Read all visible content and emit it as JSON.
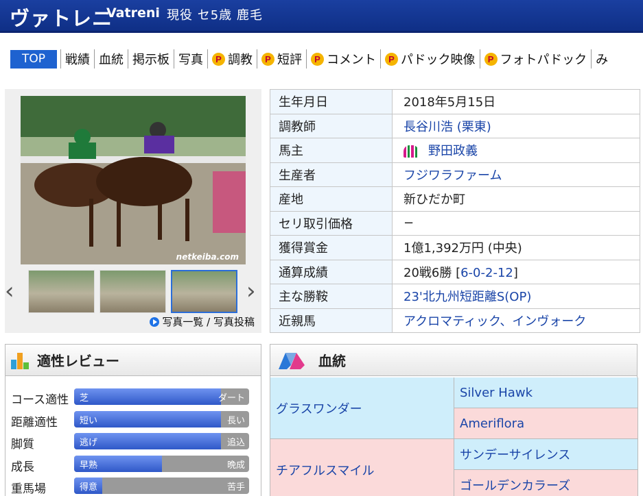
{
  "header": {
    "name_ja": "ヴァトレニ",
    "name_en": "Vatreni",
    "meta": "現役 セ5歳 鹿毛"
  },
  "nav": {
    "top_label": "TOP",
    "items": [
      {
        "label": "戦績",
        "premium": false
      },
      {
        "label": "血統",
        "premium": false
      },
      {
        "label": "掲示板",
        "premium": false
      },
      {
        "label": "写真",
        "premium": false
      },
      {
        "label": "調教",
        "premium": true
      },
      {
        "label": "短評",
        "premium": true
      },
      {
        "label": "コメント",
        "premium": true
      },
      {
        "label": "パドック映像",
        "premium": true
      },
      {
        "label": "フォトパドック",
        "premium": true
      },
      {
        "label": "み",
        "premium": false
      }
    ],
    "premium_badge": "P"
  },
  "photos": {
    "watermark": "netkeiba.com",
    "links": "写真一覧 / 写真投稿",
    "prev_arrow": "‹",
    "next_arrow": "›"
  },
  "profile": {
    "rows": [
      {
        "label": "生年月日",
        "value": "2018年5月15日",
        "link": false
      },
      {
        "label": "調教師",
        "value": "長谷川浩 (栗東)",
        "link": true
      },
      {
        "label": "馬主",
        "value": "野田政義",
        "link": true,
        "silk": true
      },
      {
        "label": "生産者",
        "value": "フジワラファーム",
        "link": true
      },
      {
        "label": "産地",
        "value": "新ひだか町",
        "link": false
      },
      {
        "label": "セリ取引価格",
        "value": "−",
        "link": false
      },
      {
        "label": "獲得賞金",
        "value": "1億1,392万円 (中央)",
        "link": false
      },
      {
        "label": "通算成績",
        "value": "20戦6勝 [",
        "value_link": "6-0-2-12",
        "value_tail": "]",
        "link": false
      },
      {
        "label": "主な勝鞍",
        "value": "23'北九州短距離S(OP)",
        "link": true
      },
      {
        "label": "近親馬",
        "value": "アクロマティック、インヴォーク",
        "link": true
      }
    ]
  },
  "aptitude": {
    "title": "適性レビュー",
    "rows": [
      {
        "label": "コース適性",
        "left": "芝",
        "right": "ダート",
        "level": 0.84
      },
      {
        "label": "距離適性",
        "left": "短い",
        "right": "長い",
        "level": 0.84
      },
      {
        "label": "脚質",
        "left": "逃げ",
        "right": "追込",
        "level": 0.84
      },
      {
        "label": "成長",
        "left": "早熟",
        "right": "晩成",
        "level": 0.5
      },
      {
        "label": "重馬場",
        "left": "得意",
        "right": "苦手",
        "level": 0.16
      }
    ]
  },
  "pedigree": {
    "title": "血統",
    "sire": "グラスワンダー",
    "dam": "チアフルスマイル",
    "sire_sire": "Silver Hawk",
    "sire_dam": "Ameriflora",
    "dam_sire": "サンデーサイレンス",
    "dam_dam": "ゴールデンカラーズ"
  },
  "colors": {
    "header_bg": "#0f2f86",
    "top_tab": "#1e62d0",
    "link": "#1a45a8",
    "pedigree_male": "#cfeefb",
    "pedigree_female": "#fbdada"
  }
}
